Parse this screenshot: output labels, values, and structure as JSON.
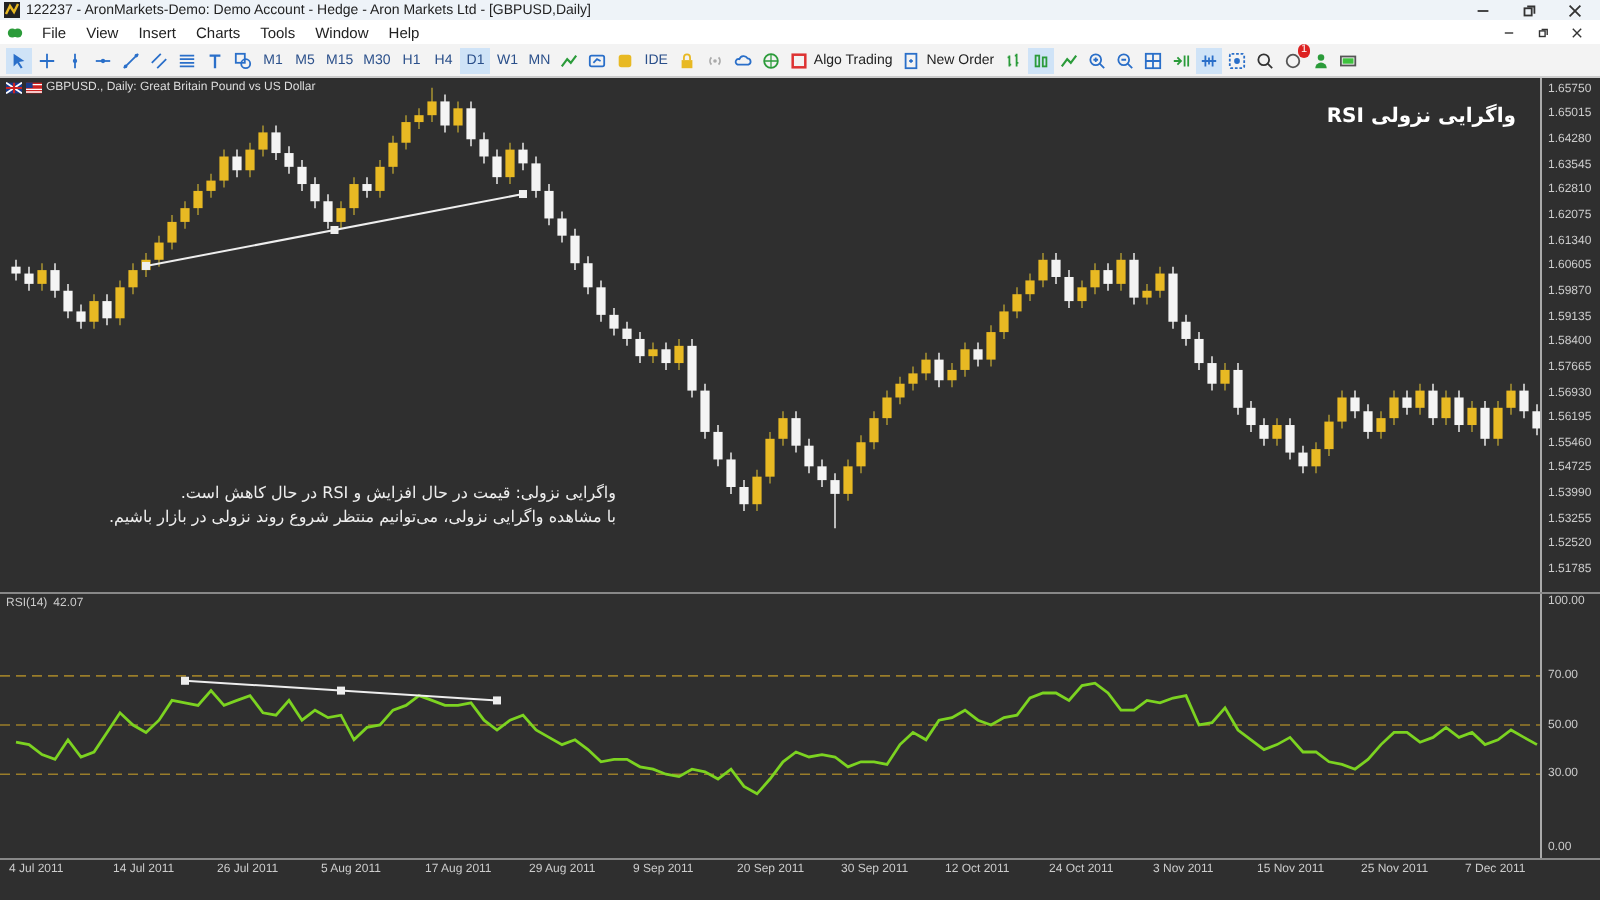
{
  "window": {
    "title": "122237 - AronMarkets-Demo: Demo Account - Hedge - Aron Markets Ltd - [GBPUSD,Daily]"
  },
  "menu": [
    "File",
    "View",
    "Insert",
    "Charts",
    "Tools",
    "Window",
    "Help"
  ],
  "toolbar": [
    {
      "kind": "cursor",
      "selected": true
    },
    {
      "kind": "crosshair",
      "selected": false
    },
    {
      "kind": "vline",
      "selected": false
    },
    {
      "kind": "hline",
      "selected": false
    },
    {
      "kind": "trendline",
      "selected": false
    },
    {
      "kind": "channel",
      "selected": false
    },
    {
      "kind": "fibo",
      "selected": false
    },
    {
      "kind": "texttool",
      "selected": false
    },
    {
      "kind": "shapes",
      "selected": false
    },
    {
      "kind": "timeframe",
      "label": "M1",
      "selected": false
    },
    {
      "kind": "timeframe",
      "label": "M5",
      "selected": false
    },
    {
      "kind": "timeframe",
      "label": "M15",
      "selected": false
    },
    {
      "kind": "timeframe",
      "label": "M30",
      "selected": false
    },
    {
      "kind": "timeframe",
      "label": "H1",
      "selected": false
    },
    {
      "kind": "timeframe",
      "label": "H4",
      "selected": false
    },
    {
      "kind": "timeframe",
      "label": "D1",
      "selected": true
    },
    {
      "kind": "timeframe",
      "label": "W1",
      "selected": false
    },
    {
      "kind": "timeframe",
      "label": "MN",
      "selected": false
    },
    {
      "kind": "indicators",
      "selected": false
    },
    {
      "kind": "template",
      "selected": false
    },
    {
      "kind": "coin",
      "selected": false
    },
    {
      "kind": "text",
      "label": "IDE",
      "selected": false
    },
    {
      "kind": "lock",
      "selected": false
    },
    {
      "kind": "signal",
      "selected": false
    },
    {
      "kind": "cloud",
      "selected": false
    },
    {
      "kind": "globe",
      "selected": false
    },
    {
      "kind": "algo",
      "label": "Algo Trading",
      "selected": false
    },
    {
      "kind": "order",
      "label": "New Order",
      "selected": false
    },
    {
      "kind": "bars",
      "selected": false
    },
    {
      "kind": "candles",
      "selected": true
    },
    {
      "kind": "line",
      "selected": false
    },
    {
      "kind": "zoomin",
      "selected": false
    },
    {
      "kind": "zoomout",
      "selected": false
    },
    {
      "kind": "grid",
      "selected": false
    },
    {
      "kind": "shift",
      "selected": false
    },
    {
      "kind": "autoscroll",
      "selected": true
    },
    {
      "kind": "screenshot",
      "selected": false
    },
    {
      "kind": "search",
      "selected": false
    },
    {
      "kind": "notify",
      "badge": "1",
      "selected": false
    },
    {
      "kind": "profile",
      "selected": false
    },
    {
      "kind": "battery",
      "selected": false
    }
  ],
  "chart_tab": {
    "label": "GBPUSD., Daily:  Great Britain Pound vs US Dollar"
  },
  "annotation_title": "واگرایی نزولی RSI",
  "annotation_text": [
    "واگرایی نزولی: قیمت در حال افزایش و RSI در حال کاهش است.",
    "با مشاهده واگرایی نزولی، می‌توانیم منتظر شروع روند نزولی در بازار باشیم."
  ],
  "price_chart": {
    "chart_data": {
      "type": "candlestick",
      "ylim": [
        1.5115,
        1.6608
      ],
      "yticks": [
        {
          "value": 1.6575,
          "label": "1.65750"
        },
        {
          "value": 1.65015,
          "label": "1.65015"
        },
        {
          "value": 1.6428,
          "label": "1.64280"
        },
        {
          "value": 1.63545,
          "label": "1.63545"
        },
        {
          "value": 1.6281,
          "label": "1.62810"
        },
        {
          "value": 1.62075,
          "label": "1.62075"
        },
        {
          "value": 1.6134,
          "label": "1.61340"
        },
        {
          "value": 1.60605,
          "label": "1.60605"
        },
        {
          "value": 1.5987,
          "label": "1.59870"
        },
        {
          "value": 1.59135,
          "label": "1.59135"
        },
        {
          "value": 1.584,
          "label": "1.58400"
        },
        {
          "value": 1.57665,
          "label": "1.57665"
        },
        {
          "value": 1.5693,
          "label": "1.56930"
        },
        {
          "value": 1.56195,
          "label": "1.56195"
        },
        {
          "value": 1.5546,
          "label": "1.55460"
        },
        {
          "value": 1.54725,
          "label": "1.54725"
        },
        {
          "value": 1.5399,
          "label": "1.53990"
        },
        {
          "value": 1.53255,
          "label": "1.53255"
        },
        {
          "value": 1.5252,
          "label": "1.52520"
        },
        {
          "value": 1.51785,
          "label": "1.51785"
        }
      ],
      "ohlc": [
        [
          1.606,
          1.608,
          1.602,
          1.604
        ],
        [
          1.604,
          1.606,
          1.599,
          1.601
        ],
        [
          1.601,
          1.607,
          1.599,
          1.605
        ],
        [
          1.605,
          1.607,
          1.597,
          1.599
        ],
        [
          1.599,
          1.601,
          1.591,
          1.593
        ],
        [
          1.593,
          1.595,
          1.588,
          1.59
        ],
        [
          1.59,
          1.598,
          1.588,
          1.596
        ],
        [
          1.596,
          1.598,
          1.589,
          1.591
        ],
        [
          1.591,
          1.602,
          1.589,
          1.6
        ],
        [
          1.6,
          1.607,
          1.598,
          1.605
        ],
        [
          1.605,
          1.61,
          1.603,
          1.608
        ],
        [
          1.608,
          1.615,
          1.606,
          1.613
        ],
        [
          1.613,
          1.621,
          1.611,
          1.619
        ],
        [
          1.619,
          1.625,
          1.617,
          1.623
        ],
        [
          1.623,
          1.63,
          1.621,
          1.628
        ],
        [
          1.628,
          1.633,
          1.626,
          1.631
        ],
        [
          1.631,
          1.64,
          1.629,
          1.638
        ],
        [
          1.638,
          1.64,
          1.632,
          1.634
        ],
        [
          1.634,
          1.642,
          1.632,
          1.64
        ],
        [
          1.64,
          1.647,
          1.638,
          1.645
        ],
        [
          1.645,
          1.647,
          1.637,
          1.639
        ],
        [
          1.639,
          1.641,
          1.633,
          1.635
        ],
        [
          1.635,
          1.637,
          1.628,
          1.63
        ],
        [
          1.63,
          1.632,
          1.623,
          1.625
        ],
        [
          1.625,
          1.627,
          1.617,
          1.619
        ],
        [
          1.619,
          1.625,
          1.617,
          1.623
        ],
        [
          1.623,
          1.632,
          1.621,
          1.63
        ],
        [
          1.63,
          1.632,
          1.626,
          1.628
        ],
        [
          1.628,
          1.637,
          1.626,
          1.635
        ],
        [
          1.635,
          1.644,
          1.633,
          1.642
        ],
        [
          1.642,
          1.65,
          1.64,
          1.648
        ],
        [
          1.648,
          1.652,
          1.646,
          1.65
        ],
        [
          1.65,
          1.658,
          1.648,
          1.654
        ],
        [
          1.654,
          1.656,
          1.645,
          1.647
        ],
        [
          1.647,
          1.654,
          1.645,
          1.652
        ],
        [
          1.652,
          1.654,
          1.641,
          1.643
        ],
        [
          1.643,
          1.645,
          1.636,
          1.638
        ],
        [
          1.638,
          1.64,
          1.63,
          1.632
        ],
        [
          1.632,
          1.642,
          1.63,
          1.64
        ],
        [
          1.64,
          1.642,
          1.634,
          1.636
        ],
        [
          1.636,
          1.638,
          1.626,
          1.628
        ],
        [
          1.628,
          1.63,
          1.618,
          1.62
        ],
        [
          1.62,
          1.622,
          1.613,
          1.615
        ],
        [
          1.615,
          1.617,
          1.605,
          1.607
        ],
        [
          1.607,
          1.609,
          1.598,
          1.6
        ],
        [
          1.6,
          1.602,
          1.59,
          1.592
        ],
        [
          1.592,
          1.594,
          1.586,
          1.588
        ],
        [
          1.588,
          1.59,
          1.583,
          1.585
        ],
        [
          1.585,
          1.587,
          1.578,
          1.58
        ],
        [
          1.58,
          1.584,
          1.578,
          1.582
        ],
        [
          1.582,
          1.584,
          1.576,
          1.578
        ],
        [
          1.578,
          1.585,
          1.576,
          1.583
        ],
        [
          1.583,
          1.585,
          1.568,
          1.57
        ],
        [
          1.57,
          1.572,
          1.556,
          1.558
        ],
        [
          1.558,
          1.56,
          1.548,
          1.55
        ],
        [
          1.55,
          1.552,
          1.54,
          1.542
        ],
        [
          1.542,
          1.544,
          1.535,
          1.537
        ],
        [
          1.537,
          1.547,
          1.535,
          1.545
        ],
        [
          1.545,
          1.558,
          1.543,
          1.556
        ],
        [
          1.556,
          1.564,
          1.554,
          1.562
        ],
        [
          1.562,
          1.564,
          1.552,
          1.554
        ],
        [
          1.554,
          1.556,
          1.546,
          1.548
        ],
        [
          1.548,
          1.55,
          1.542,
          1.544
        ],
        [
          1.544,
          1.546,
          1.53,
          1.54
        ],
        [
          1.54,
          1.55,
          1.538,
          1.548
        ],
        [
          1.548,
          1.557,
          1.546,
          1.555
        ],
        [
          1.555,
          1.564,
          1.553,
          1.562
        ],
        [
          1.562,
          1.57,
          1.56,
          1.568
        ],
        [
          1.568,
          1.574,
          1.566,
          1.572
        ],
        [
          1.572,
          1.577,
          1.57,
          1.575
        ],
        [
          1.575,
          1.581,
          1.573,
          1.579
        ],
        [
          1.579,
          1.581,
          1.571,
          1.573
        ],
        [
          1.573,
          1.578,
          1.571,
          1.576
        ],
        [
          1.576,
          1.584,
          1.574,
          1.582
        ],
        [
          1.582,
          1.584,
          1.577,
          1.579
        ],
        [
          1.579,
          1.589,
          1.577,
          1.587
        ],
        [
          1.587,
          1.595,
          1.585,
          1.593
        ],
        [
          1.593,
          1.6,
          1.591,
          1.598
        ],
        [
          1.598,
          1.604,
          1.596,
          1.602
        ],
        [
          1.602,
          1.61,
          1.6,
          1.608
        ],
        [
          1.608,
          1.61,
          1.601,
          1.603
        ],
        [
          1.603,
          1.605,
          1.594,
          1.596
        ],
        [
          1.596,
          1.602,
          1.594,
          1.6
        ],
        [
          1.6,
          1.607,
          1.598,
          1.605
        ],
        [
          1.605,
          1.607,
          1.599,
          1.601
        ],
        [
          1.601,
          1.61,
          1.599,
          1.608
        ],
        [
          1.608,
          1.61,
          1.595,
          1.597
        ],
        [
          1.597,
          1.601,
          1.595,
          1.599
        ],
        [
          1.599,
          1.606,
          1.597,
          1.604
        ],
        [
          1.604,
          1.606,
          1.588,
          1.59
        ],
        [
          1.59,
          1.592,
          1.583,
          1.585
        ],
        [
          1.585,
          1.587,
          1.576,
          1.578
        ],
        [
          1.578,
          1.58,
          1.57,
          1.572
        ],
        [
          1.572,
          1.578,
          1.57,
          1.576
        ],
        [
          1.576,
          1.578,
          1.563,
          1.565
        ],
        [
          1.565,
          1.567,
          1.558,
          1.56
        ],
        [
          1.56,
          1.562,
          1.554,
          1.556
        ],
        [
          1.556,
          1.562,
          1.554,
          1.56
        ],
        [
          1.56,
          1.562,
          1.55,
          1.552
        ],
        [
          1.552,
          1.554,
          1.546,
          1.548
        ],
        [
          1.548,
          1.555,
          1.546,
          1.553
        ],
        [
          1.553,
          1.563,
          1.551,
          1.561
        ],
        [
          1.561,
          1.57,
          1.559,
          1.568
        ],
        [
          1.568,
          1.57,
          1.562,
          1.564
        ],
        [
          1.564,
          1.566,
          1.556,
          1.558
        ],
        [
          1.558,
          1.564,
          1.556,
          1.562
        ],
        [
          1.562,
          1.57,
          1.56,
          1.568
        ],
        [
          1.568,
          1.57,
          1.563,
          1.565
        ],
        [
          1.565,
          1.572,
          1.563,
          1.57
        ],
        [
          1.57,
          1.572,
          1.56,
          1.562
        ],
        [
          1.562,
          1.57,
          1.56,
          1.568
        ],
        [
          1.568,
          1.57,
          1.558,
          1.56
        ],
        [
          1.56,
          1.567,
          1.558,
          1.565
        ],
        [
          1.565,
          1.567,
          1.554,
          1.556
        ],
        [
          1.556,
          1.567,
          1.554,
          1.565
        ],
        [
          1.565,
          1.572,
          1.563,
          1.57
        ],
        [
          1.57,
          1.572,
          1.562,
          1.564
        ],
        [
          1.564,
          1.566,
          1.557,
          1.559
        ]
      ]
    }
  },
  "rsi_chart": {
    "value": "42.07",
    "chart_data": {
      "type": "line",
      "ylim": [
        -4.1,
        103.3
      ],
      "grid": true,
      "yticks": [
        {
          "value": 100,
          "label": "100.00"
        },
        {
          "value": 70,
          "label": "70.00"
        },
        {
          "value": 50,
          "label": "50.00"
        },
        {
          "value": 30,
          "label": "30.00"
        },
        {
          "value": 0,
          "label": "0.00"
        }
      ],
      "series": [
        {
          "name": "RSI(14)",
          "color": "#7cd321",
          "values": [
            43,
            42,
            38,
            36,
            44,
            37,
            39,
            47,
            55,
            50,
            47,
            52,
            60,
            59,
            58,
            64,
            58,
            60,
            62,
            55,
            54,
            60,
            52,
            56,
            53,
            54,
            44,
            49,
            50,
            56,
            58,
            62,
            60,
            58,
            58,
            59,
            52,
            48,
            52,
            54,
            48,
            45,
            42,
            44,
            40,
            35,
            36,
            36,
            33,
            32,
            30,
            29,
            32,
            31,
            28,
            32,
            25,
            22,
            28,
            35,
            39,
            37,
            38,
            37,
            33,
            35,
            35,
            34,
            42,
            47,
            44,
            52,
            53,
            56,
            52,
            50,
            53,
            54,
            61,
            63,
            63,
            60,
            66,
            67,
            63,
            56,
            56,
            60,
            59,
            61,
            62,
            50,
            51,
            57,
            48,
            44,
            40,
            42,
            45,
            39,
            39,
            35,
            34,
            32,
            36,
            42,
            47,
            47,
            43,
            45,
            49,
            45,
            47,
            42,
            44,
            48,
            45,
            42
          ]
        }
      ]
    }
  },
  "date_axis": [
    "4 Jul 2011",
    "14 Jul 2011",
    "26 Jul 2011",
    "5 Aug 2011",
    "17 Aug 2011",
    "29 Aug 2011",
    "9 Sep 2011",
    "20 Sep 2011",
    "30 Sep 2011",
    "12 Oct 2011",
    "24 Oct 2011",
    "3 Nov 2011",
    "15 Nov 2011",
    "25 Nov 2011",
    "7 Dec 2011"
  ]
}
